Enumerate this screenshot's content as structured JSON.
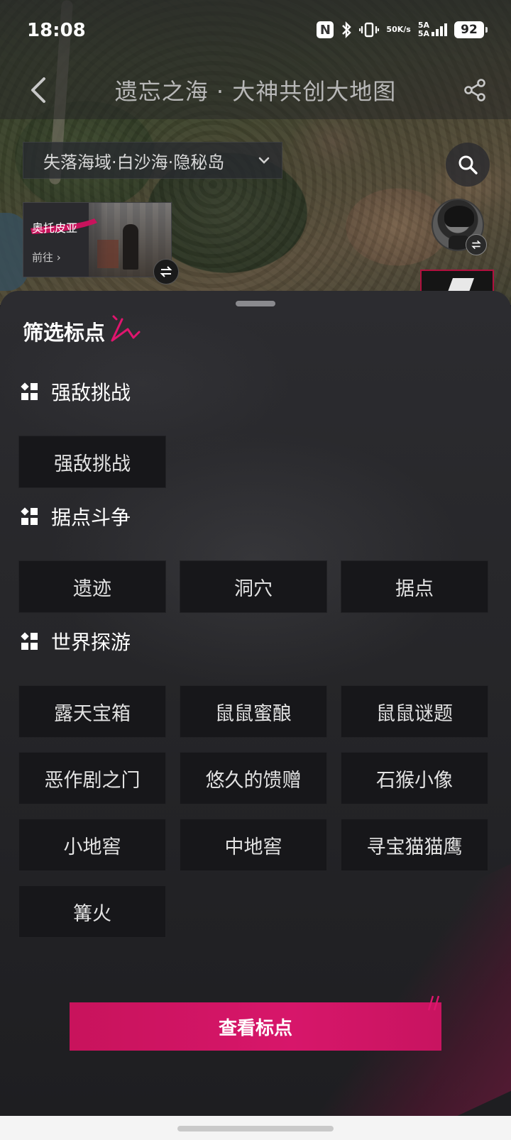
{
  "status_bar": {
    "time": "18:08",
    "nfc": "N",
    "net_speed_top": "50",
    "net_speed_bottom": "K/s",
    "signal_top": "5A",
    "signal_bottom": "5A",
    "battery": "92"
  },
  "header": {
    "title": "遗忘之海 · 大神共创大地图"
  },
  "region": {
    "current": "失落海域·白沙海·隐秘岛"
  },
  "location_card": {
    "name": "奥托皮亚",
    "go_label": "前往 ›"
  },
  "sheet": {
    "title": "筛选标点",
    "sections": [
      {
        "label": "强敌挑战",
        "chips": [
          "强敌挑战"
        ]
      },
      {
        "label": "据点斗争",
        "chips": [
          "遗迹",
          "洞穴",
          "据点"
        ]
      },
      {
        "label": "世界探游",
        "chips": [
          "露天宝箱",
          "鼠鼠蜜酿",
          "鼠鼠谜题",
          "恶作剧之门",
          "悠久的馈赠",
          "石猴小像",
          "小地窖",
          "中地窖",
          "寻宝猫猫鹰",
          "篝火"
        ]
      }
    ],
    "cta_label": "查看标点"
  },
  "colors": {
    "accent": "#d7166a",
    "chip_bg": "#17171a",
    "sheet_bg": "#262629"
  }
}
